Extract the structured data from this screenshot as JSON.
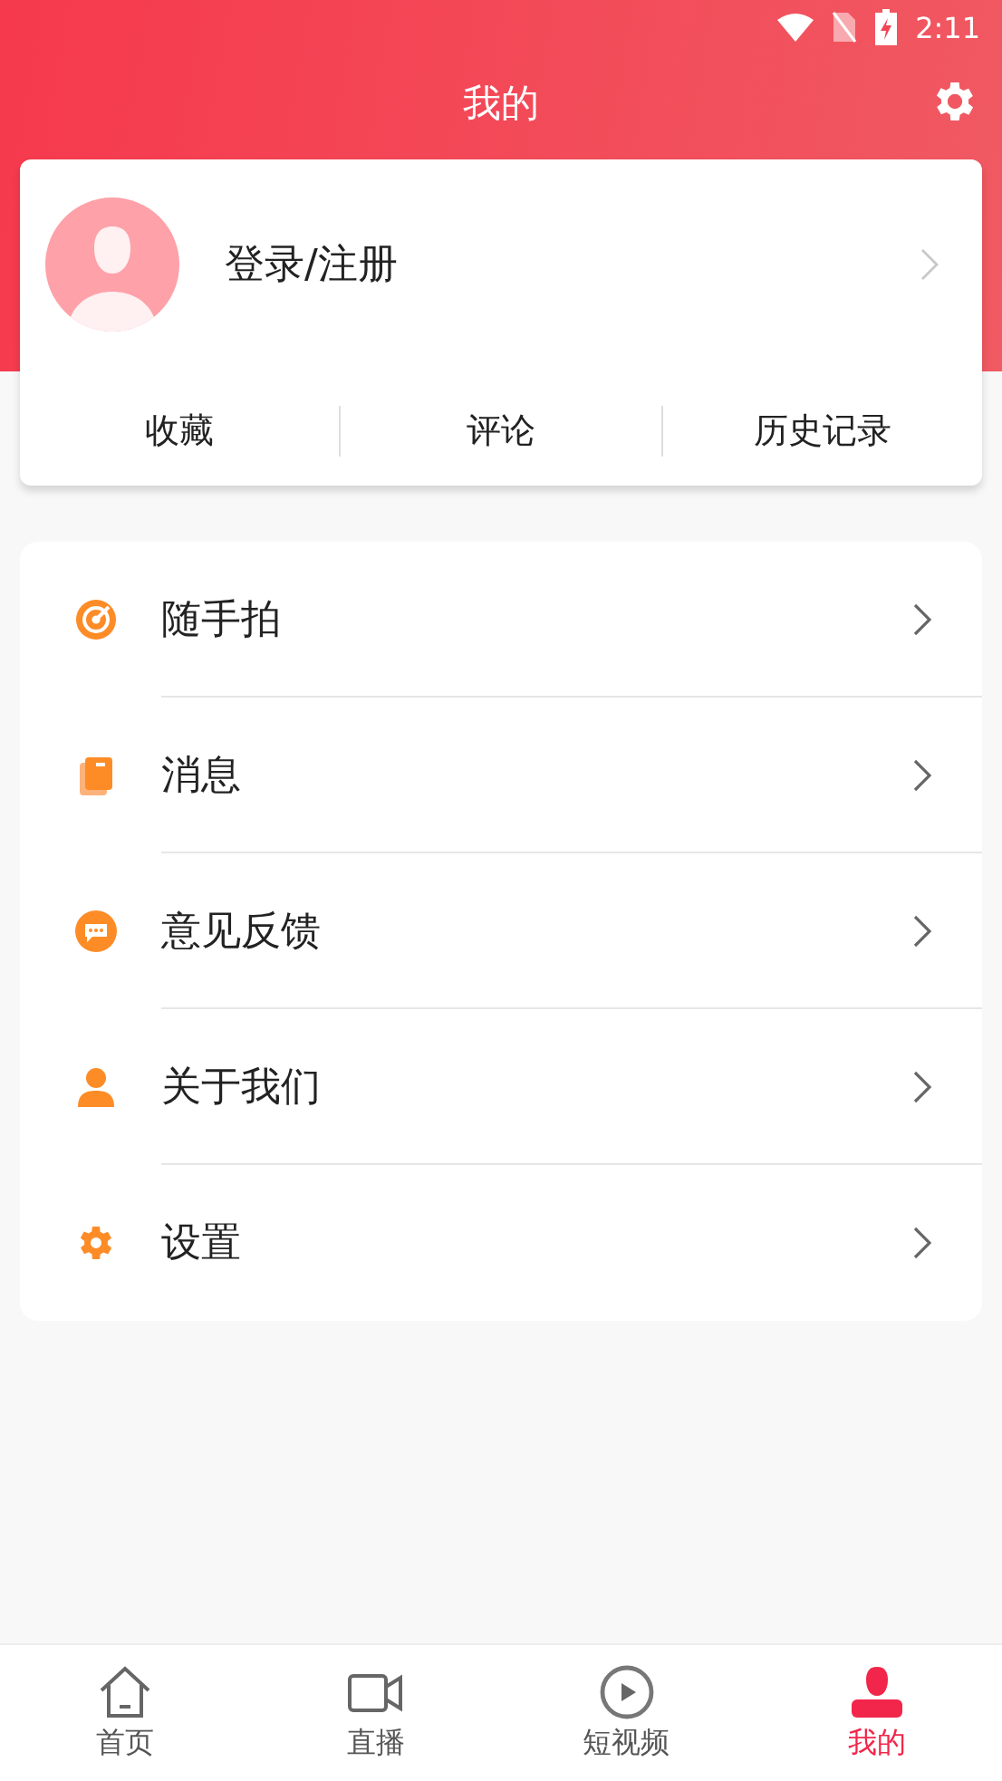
{
  "status_bar": {
    "time": "2:11"
  },
  "header": {
    "title": "我的"
  },
  "profile": {
    "login": "登录/注册"
  },
  "shortcuts": [
    "收藏",
    "评论",
    "历史记录"
  ],
  "menu": [
    {
      "kind": "target",
      "label": "随手拍"
    },
    {
      "kind": "book",
      "label": "消息"
    },
    {
      "kind": "chat",
      "label": "意见反馈"
    },
    {
      "kind": "person",
      "label": "关于我们"
    },
    {
      "kind": "gear",
      "label": "设置"
    }
  ],
  "tabs": [
    {
      "kind": "home",
      "label": "首页",
      "selected": false
    },
    {
      "kind": "video",
      "label": "直播",
      "selected": false
    },
    {
      "kind": "play",
      "label": "短视频",
      "selected": false
    },
    {
      "kind": "person",
      "label": "我的",
      "selected": true
    }
  ]
}
